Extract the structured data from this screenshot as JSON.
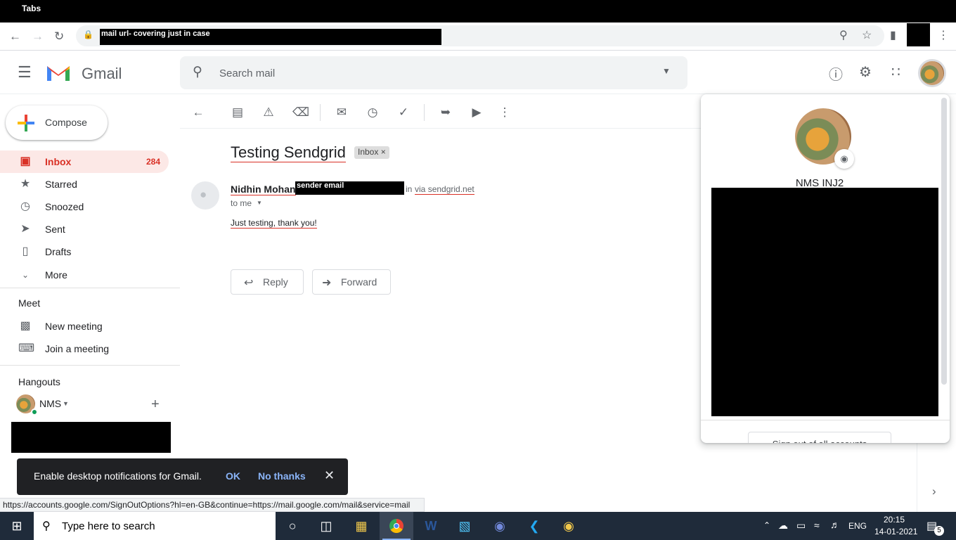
{
  "browser": {
    "tab_strip_title": "Tabs",
    "url_text": "mail url- covering just in case",
    "status_url": "https://accounts.google.com/SignOutOptions?hl=en-GB&continue=https://mail.google.com/mail&service=mail"
  },
  "header": {
    "logo_text": "Gmail",
    "search_placeholder": "Search mail"
  },
  "sidebar": {
    "compose_label": "Compose",
    "items": [
      {
        "label": "Inbox",
        "count": "284",
        "icon": "inbox-icon"
      },
      {
        "label": "Starred",
        "icon": "star-icon"
      },
      {
        "label": "Snoozed",
        "icon": "clock-icon"
      },
      {
        "label": "Sent",
        "icon": "send-icon"
      },
      {
        "label": "Drafts",
        "icon": "draft-icon"
      },
      {
        "label": "More",
        "icon": "chevron-down-icon"
      }
    ],
    "meet_heading": "Meet",
    "meet_items": [
      {
        "label": "New meeting",
        "icon": "video-icon"
      },
      {
        "label": "Join a meeting",
        "icon": "keyboard-icon"
      }
    ],
    "hangouts_heading": "Hangouts",
    "hangouts_user": "NMS"
  },
  "message": {
    "subject": "Testing Sendgrid",
    "label_chip": "Inbox",
    "sender_name": "Nidhin Mohan",
    "sender_email_cover": "sender email",
    "via_prefix": "in",
    "via_word": "via",
    "via_domain": "sendgrid.net",
    "to_line": "to me",
    "body": "Just testing, thank you!",
    "reply_label": "Reply",
    "forward_label": "Forward"
  },
  "account_popup": {
    "name": "NMS INJ2",
    "bottom_button": "Sign out of all accounts"
  },
  "notification": {
    "text": "Enable desktop notifications for Gmail.",
    "ok": "OK",
    "no_thanks": "No thanks"
  },
  "taskbar": {
    "search_placeholder": "Type here to search",
    "language": "ENG",
    "time": "20:15",
    "date": "14-01-2021",
    "notification_count": "5"
  },
  "colors": {
    "accent_red": "#d93025",
    "blue_link": "#8ab4f8",
    "taskbar": "#1f2b3a"
  }
}
